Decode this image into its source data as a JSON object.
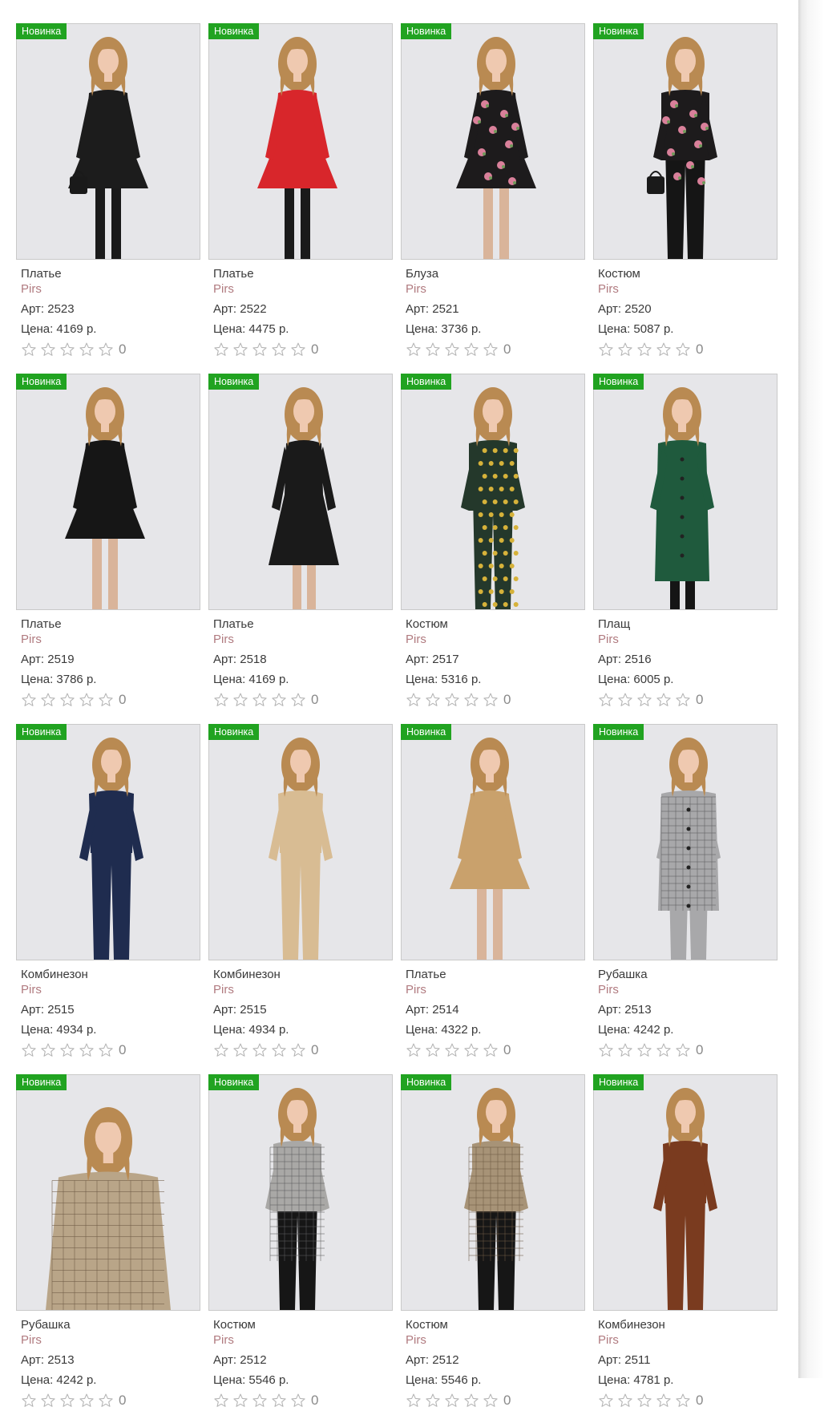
{
  "badge_label": "Новинка",
  "label_art": "Арт:",
  "label_price": "Цена:",
  "currency": "р.",
  "previous_row": {
    "review_count": "0"
  },
  "products": [
    {
      "name": "Платье",
      "brand": "Pirs",
      "art": "2523",
      "price": "4169",
      "reviews": "0",
      "image": {
        "outfit": "black dress",
        "top": "#1c1c1c",
        "bottom": "#1c1c1c",
        "pattern": "none",
        "type": "dress",
        "bag": true
      }
    },
    {
      "name": "Платье",
      "brand": "Pirs",
      "art": "2522",
      "price": "4475",
      "reviews": "0",
      "image": {
        "outfit": "red coat dress",
        "top": "#d8262b",
        "bottom": "#d8262b",
        "pattern": "none",
        "type": "dress",
        "boots": true
      }
    },
    {
      "name": "Блуза",
      "brand": "Pirs",
      "art": "2521",
      "price": "3736",
      "reviews": "0",
      "image": {
        "outfit": "black floral blouse",
        "top": "#1d1b1c",
        "bottom": "#1d1b1c",
        "pattern": "floral",
        "type": "dress"
      }
    },
    {
      "name": "Костюм",
      "brand": "Pirs",
      "art": "2520",
      "price": "5087",
      "reviews": "0",
      "image": {
        "outfit": "floral top black trousers",
        "top": "#1d1b1c",
        "bottom": "#151515",
        "pattern": "floral",
        "type": "suit",
        "bag": true
      }
    },
    {
      "name": "Платье",
      "brand": "Pirs",
      "art": "2519",
      "price": "3786",
      "reviews": "0",
      "image": {
        "outfit": "black sheer sleeve dress",
        "top": "#161616",
        "bottom": "#161616",
        "pattern": "none",
        "type": "dress"
      }
    },
    {
      "name": "Платье",
      "brand": "Pirs",
      "art": "2518",
      "price": "4169",
      "reviews": "0",
      "image": {
        "outfit": "black lace midi dress",
        "top": "#1a1a1a",
        "bottom": "#1a1a1a",
        "pattern": "none",
        "type": "midi"
      }
    },
    {
      "name": "Костюм",
      "brand": "Pirs",
      "art": "2517",
      "price": "5316",
      "reviews": "0",
      "image": {
        "outfit": "green print suit",
        "top": "#24382b",
        "bottom": "#24382b",
        "pattern": "dots",
        "type": "suit"
      }
    },
    {
      "name": "Плащ",
      "brand": "Pirs",
      "art": "2516",
      "price": "6005",
      "reviews": "0",
      "image": {
        "outfit": "green trench",
        "top": "#1f5a3d",
        "bottom": "#1f5a3d",
        "pattern": "none",
        "type": "coat"
      }
    },
    {
      "name": "Комбинезон",
      "brand": "Pirs",
      "art": "2515",
      "price": "4934",
      "reviews": "0",
      "image": {
        "outfit": "navy jumpsuit",
        "top": "#1f2c4f",
        "bottom": "#1f2c4f",
        "pattern": "none",
        "type": "jumpsuit"
      }
    },
    {
      "name": "Комбинезон",
      "brand": "Pirs",
      "art": "2515",
      "price": "4934",
      "reviews": "0",
      "image": {
        "outfit": "beige jumpsuit",
        "top": "#d8bc93",
        "bottom": "#d8bc93",
        "pattern": "none",
        "type": "jumpsuit"
      }
    },
    {
      "name": "Платье",
      "brand": "Pirs",
      "art": "2514",
      "price": "4322",
      "reviews": "0",
      "image": {
        "outfit": "camel shirt dress",
        "top": "#c9a16c",
        "bottom": "#c9a16c",
        "pattern": "none",
        "type": "dress"
      }
    },
    {
      "name": "Рубашка",
      "brand": "Pirs",
      "art": "2513",
      "price": "4242",
      "reviews": "0",
      "image": {
        "outfit": "grey check overshirt",
        "top": "#a8a8aa",
        "bottom": "#a8a8aa",
        "pattern": "check",
        "type": "shirt"
      }
    },
    {
      "name": "Рубашка",
      "brand": "Pirs",
      "art": "2513",
      "price": "4242",
      "reviews": "0",
      "image": {
        "outfit": "beige check shirt",
        "top": "#b9a588",
        "bottom": "#1a1a1a",
        "pattern": "plaid",
        "type": "shirt-close"
      }
    },
    {
      "name": "Костюм",
      "brand": "Pirs",
      "art": "2512",
      "price": "5546",
      "reviews": "0",
      "image": {
        "outfit": "grey check jacket black trousers",
        "top": "#a9a8a6",
        "bottom": "#161616",
        "pattern": "check",
        "type": "suit"
      }
    },
    {
      "name": "Костюм",
      "brand": "Pirs",
      "art": "2512",
      "price": "5546",
      "reviews": "0",
      "image": {
        "outfit": "plaid jacket black trousers",
        "top": "#a79377",
        "bottom": "#161616",
        "pattern": "plaid",
        "type": "suit"
      }
    },
    {
      "name": "Комбинезон",
      "brand": "Pirs",
      "art": "2511",
      "price": "4781",
      "reviews": "0",
      "image": {
        "outfit": "brown leather jumpsuit",
        "top": "#7a3b1f",
        "bottom": "#7a3b1f",
        "pattern": "none",
        "type": "jumpsuit"
      }
    }
  ]
}
